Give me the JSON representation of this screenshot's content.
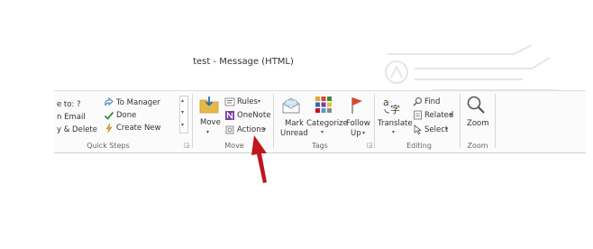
{
  "window": {
    "title": "test  -  Message (HTML)"
  },
  "quick_steps": {
    "items": [
      "e to: ?",
      "n Email",
      "y & Delete",
      "To Manager",
      "Done",
      "Create New"
    ],
    "label": "Quick Steps"
  },
  "move": {
    "move_label": "Move",
    "rules_label": "Rules",
    "onenote_label": "OneNote",
    "actions_label": "Actions",
    "label": "Move"
  },
  "tags": {
    "mark_unread_line1": "Mark",
    "mark_unread_line2": "Unread",
    "categorize_label": "Categorize",
    "follow_up_line1": "Follow",
    "follow_up_line2": "Up",
    "label": "Tags"
  },
  "editing": {
    "translate_label": "Translate",
    "find_label": "Find",
    "related_label": "Related",
    "select_label": "Select",
    "label": "Editing"
  },
  "zoom": {
    "zoom_label": "Zoom",
    "label": "Zoom"
  },
  "colors": {
    "arrow": "#c0161c",
    "ribbon_bg": "#fbfbfb",
    "folder": "#e6b84a",
    "flag": "#d9472b"
  },
  "dropdown_caret": "▾",
  "launcher_glyph": "◲"
}
